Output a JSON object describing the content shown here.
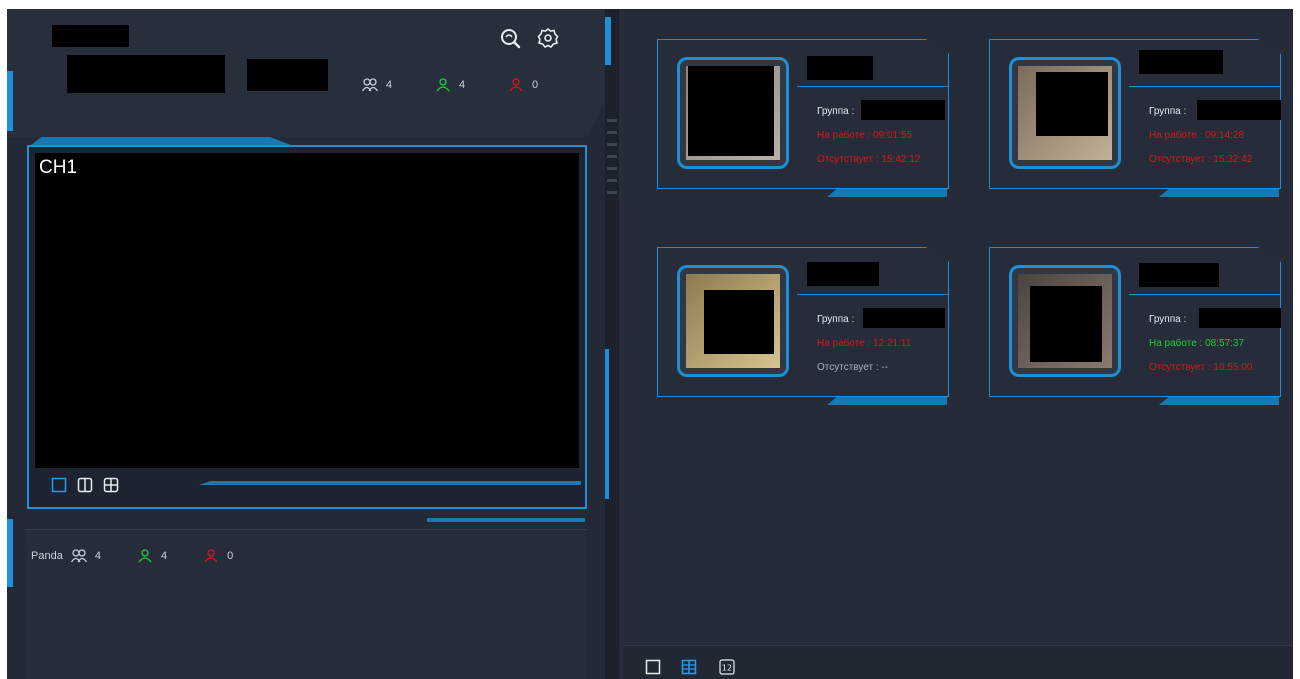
{
  "left": {
    "channel_label": "CH1",
    "stats_top": {
      "total": "4",
      "present": "4",
      "absent": "0"
    },
    "group_stats": {
      "group_name": "Panda",
      "total": "4",
      "present": "4",
      "absent": "0"
    }
  },
  "cards": [
    {
      "group_label": "Группа :",
      "work_text": "На работе : 09:01:55",
      "work_color": "red",
      "absent_text": "Отсутствует : 15:42:12",
      "absent_color": "red"
    },
    {
      "group_label": "Группа :",
      "work_text": "На работе : 09:14:28",
      "work_color": "red",
      "absent_text": "Отсутствует : 15:32:42",
      "absent_color": "red"
    },
    {
      "group_label": "Группа :",
      "work_text": "На работе : 12:21:11",
      "work_color": "red",
      "absent_text": "Отсутствует : --",
      "absent_color": "gray"
    },
    {
      "group_label": "Группа :",
      "work_text": "На работе : 08:57:37",
      "work_color": "green",
      "absent_text": "Отсутствует : 10:55:00",
      "absent_color": "red"
    }
  ],
  "bottom": {
    "view_12_label": "12"
  },
  "colors": {
    "accent": "#1f8fd6",
    "present": "#1bcf3b",
    "absent": "#e0141c",
    "background": "#262c39"
  },
  "icons": [
    "search-icon",
    "settings-icon",
    "group-icon",
    "user-present-icon",
    "user-absent-icon",
    "view-1-icon",
    "view-2-icon",
    "view-4-icon",
    "grid-icon"
  ]
}
